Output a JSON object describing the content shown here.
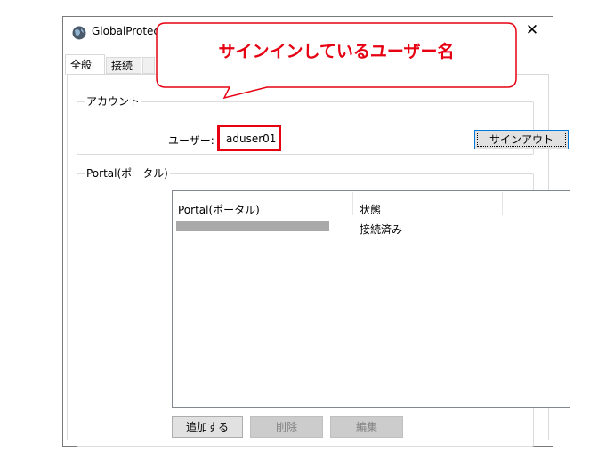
{
  "window": {
    "title": "GlobalProtect",
    "close_label": "✕"
  },
  "tabs": [
    {
      "label": "全般"
    },
    {
      "label": "接続"
    }
  ],
  "account": {
    "group_label": "アカウント",
    "user_label": "ユーザー:",
    "user_value": "aduser01",
    "signout_label": "サインアウト"
  },
  "portal": {
    "group_label": "Portal(ポータル)",
    "columns": [
      "Portal(ポータル)",
      "状態"
    ],
    "rows": [
      {
        "portal": "",
        "status": "接続済み"
      }
    ]
  },
  "buttons": {
    "add": "追加する",
    "delete": "削除",
    "edit": "編集"
  },
  "annotation": {
    "callout_text": "サインインしているユーザー名"
  },
  "colors": {
    "annotation_red": "#e60012",
    "focus_blue": "#0078d7"
  },
  "icons": {
    "app": "globalprotect-globe-icon",
    "close": "close-icon"
  }
}
